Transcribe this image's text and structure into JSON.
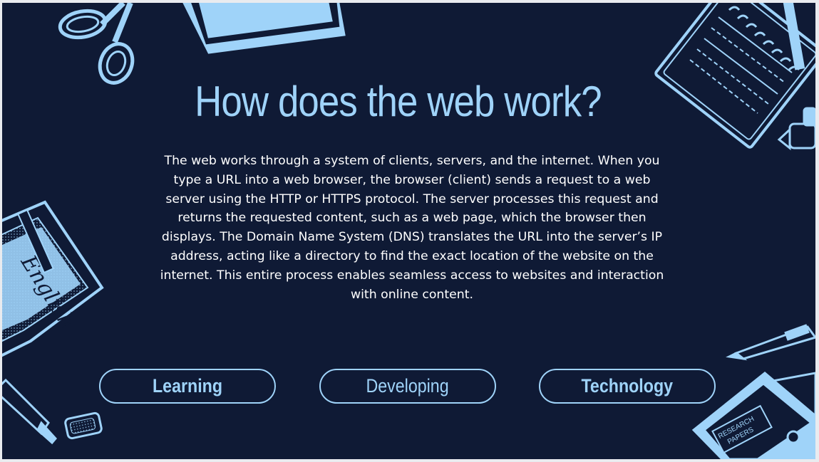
{
  "slide": {
    "title": "How does the web work?",
    "body": "The web works through a system of clients, servers, and the internet. When you type a URL into a web browser, the browser (client) sends a request to a web server using the HTTP or HTTPS protocol. The server processes this request and returns the requested content, such as a web page, which the browser then displays. The Domain Name System (DNS) translates the URL into the server’s IP address, acting like a directory to find the exact location of the website on the internet. This entire process enables seamless access to websites and interaction with online content."
  },
  "buttons": [
    {
      "label": "Learning"
    },
    {
      "label": "Developing"
    },
    {
      "label": "Technology"
    }
  ],
  "decorations": {
    "notebook_label": "English",
    "folder_label": "RESEARCH PAPERS",
    "icons": [
      "scissors-icon",
      "papers-icon",
      "spiral-notebook-icon",
      "dropper-icon",
      "english-book-icon",
      "pen-icon",
      "marker-icon",
      "research-folder-icon"
    ]
  },
  "colors": {
    "background": "#0f1a35",
    "accent": "#9fd3f9",
    "text": "#ffffff"
  }
}
